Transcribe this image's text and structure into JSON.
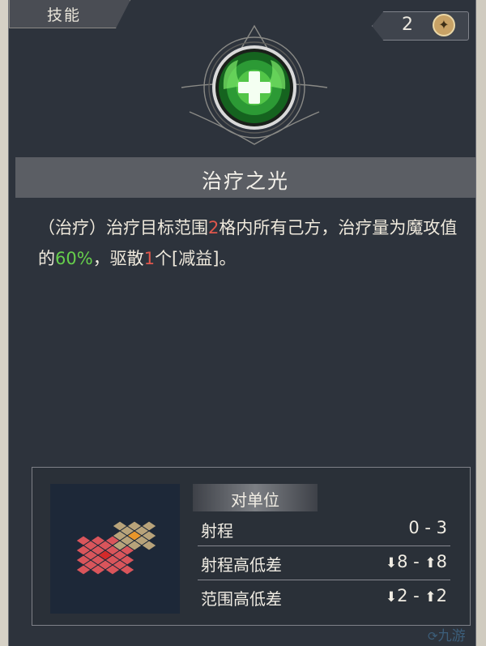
{
  "tab": {
    "label": "技能"
  },
  "cost": {
    "value": "2",
    "icon": "star-badge-icon"
  },
  "skill": {
    "icon": "heal-cross-icon",
    "name": "治疗之光",
    "desc_segments": [
      {
        "text": "（治疗）治疗目标范围",
        "style": "normal"
      },
      {
        "text": "2",
        "style": "red"
      },
      {
        "text": "格内所有己方，治疗量为魔攻值的",
        "style": "normal"
      },
      {
        "text": "60%",
        "style": "green"
      },
      {
        "text": "，驱散",
        "style": "normal"
      },
      {
        "text": "1",
        "style": "red"
      },
      {
        "text": "个[减益]。",
        "style": "normal"
      }
    ]
  },
  "info": {
    "target_label": "对单位",
    "rows": [
      {
        "key": "射程",
        "value": "0 - 3"
      },
      {
        "key": "射程高低差",
        "down_icon": "arrow-down-icon",
        "down": "8",
        "sep": " - ",
        "up_icon": "arrow-up-icon",
        "up": "8"
      },
      {
        "key": "范围高低差",
        "down_icon": "arrow-down-icon",
        "down": "2",
        "sep": " - ",
        "up_icon": "arrow-up-icon",
        "up": "2"
      }
    ]
  },
  "colors": {
    "panel": "#2d333c",
    "highlight_red": "#e0574c",
    "highlight_green": "#66cf4c",
    "range_tile": "#d9555b",
    "area_tile": "#b8a37a",
    "origin_tile": "#d42a2a",
    "center_tile": "#e8962a"
  },
  "watermark": {
    "text": "九游",
    "icon": "nine-game-logo-icon"
  }
}
